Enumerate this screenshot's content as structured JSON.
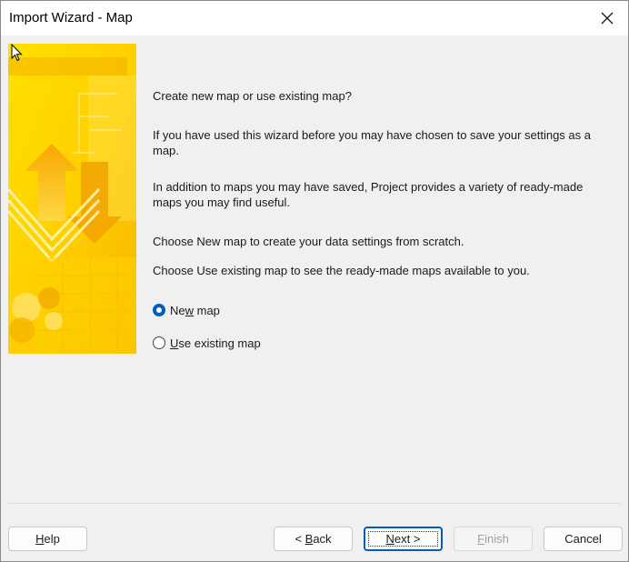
{
  "window": {
    "title": "Import Wizard - Map"
  },
  "content": {
    "question": "Create new map or use existing map?",
    "para1": "If you have used this wizard before you may have chosen to save your settings as a map.",
    "para2": "In addition to maps you may have saved, Project provides a variety of ready-made maps you may find useful.",
    "para3": "Choose New map to create your data settings from scratch.",
    "para4": "Choose Use existing map to see the ready-made maps available to you."
  },
  "options": {
    "new_map": {
      "pre": "Ne",
      "accel": "w",
      "post": " map",
      "checked": true
    },
    "use_existing": {
      "pre": "",
      "accel": "U",
      "post": "se existing map",
      "checked": false
    }
  },
  "buttons": {
    "help": {
      "pre": "",
      "accel": "H",
      "post": "elp"
    },
    "back": {
      "pre": "< ",
      "accel": "B",
      "post": "ack"
    },
    "next": {
      "pre": "",
      "accel": "N",
      "post": "ext >"
    },
    "finish": {
      "pre": "",
      "accel": "F",
      "post": "inish"
    },
    "cancel": {
      "label": "Cancel"
    }
  },
  "colors": {
    "accent": "#005fb8",
    "image_yellow": "#ffd400",
    "image_orange": "#f5a800"
  },
  "icons": [
    "close-icon",
    "mouse-cursor-icon",
    "wizard-banner-image"
  ]
}
